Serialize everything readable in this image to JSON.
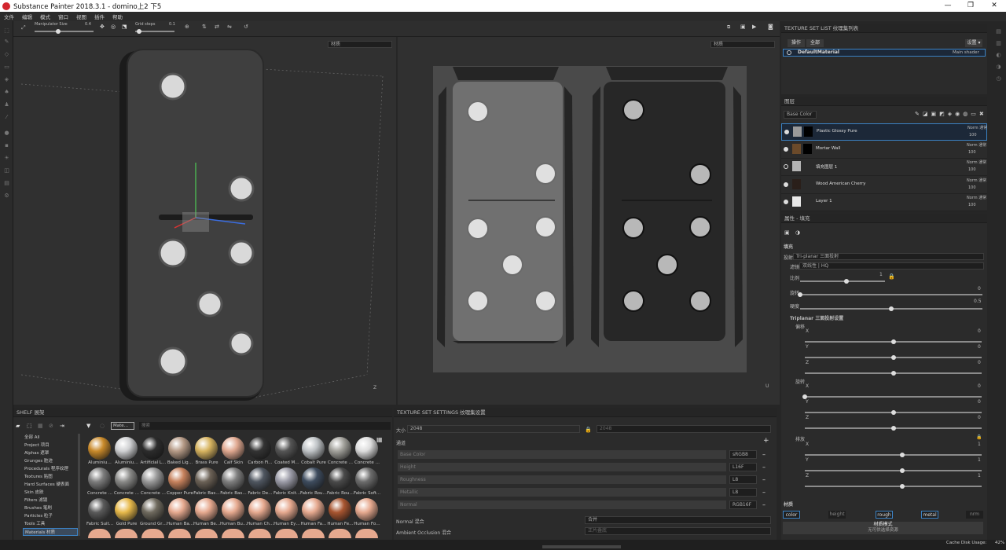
{
  "title": "Substance Painter 2018.3.1 - domino上2 下5",
  "window_controls": [
    "—",
    "❐",
    "✕"
  ],
  "menu": [
    "文件",
    "编辑",
    "模式",
    "窗口",
    "视图",
    "插件",
    "帮助"
  ],
  "toolbar": {
    "manipulator_label": "Manipulator Size",
    "manipulator_value": "0.4",
    "grid_label": "Grid steps",
    "grid_value": "0.1",
    "manipulator_frac": 0.4,
    "grid_frac": 0.1
  },
  "viewport3d": {
    "mode": "材质",
    "axis": "Z"
  },
  "viewport2d": {
    "mode": "材质",
    "axis": "U"
  },
  "texset_list": {
    "title": "TEXTURE SET LIST 纹理集列表",
    "btn1": "操作",
    "btn2": "全部",
    "settings": "设置 ▾",
    "item": "DefaultMaterial",
    "shader": "Main shader"
  },
  "layers": {
    "title": "图层",
    "channel": "Base Color",
    "items": [
      {
        "name": "Plastic Glossy Pure",
        "blend": "Norm 通常",
        "opacity": "100",
        "selected": true
      },
      {
        "name": "Mortar Wall",
        "blend": "Norm 通常",
        "opacity": "100",
        "selected": false
      },
      {
        "name": "填充图层 1",
        "blend": "Norm 通常",
        "opacity": "100",
        "selected": false
      },
      {
        "name": "Wood American Cherry",
        "blend": "Norm 通常",
        "opacity": "100",
        "selected": false
      },
      {
        "name": "Layer 1",
        "blend": "Norm 通常",
        "opacity": "100",
        "selected": false
      }
    ]
  },
  "properties": {
    "title": "属性 - 填充",
    "fill_title": "填充",
    "projection_label": "投射",
    "projection": "Tri-planar 三面投射",
    "filter_label": "滤镜",
    "filter": "双线性 | HQ",
    "scale_label": "比例",
    "scale_value": "1",
    "rotation_label": "旋转",
    "rotation_value": "0",
    "hardness_label": "硬度",
    "hardness_value": "0.5",
    "triplanar_title": "Triplanar 三面投射设置",
    "offset_label": "偏移",
    "rotate_label": "旋转",
    "tile_label": "排放",
    "offset": [
      {
        "axis": "X",
        "value": "0"
      },
      {
        "axis": "Y",
        "value": "0"
      },
      {
        "axis": "Z",
        "value": "0"
      }
    ],
    "rotate": [
      {
        "axis": "X",
        "value": "0"
      },
      {
        "axis": "Y",
        "value": "0"
      },
      {
        "axis": "Z",
        "value": "0"
      }
    ],
    "tile": [
      {
        "axis": "X",
        "value": "1"
      },
      {
        "axis": "Y",
        "value": "1"
      },
      {
        "axis": "Z",
        "value": "1"
      }
    ],
    "material_title": "材质",
    "channels": [
      "color",
      "height",
      "rough",
      "metal",
      "nrm"
    ],
    "material_mode": "材质模式",
    "material_mode_sub": "无可供选择资源"
  },
  "shelf": {
    "title": "SHELF 展架",
    "search_tag": "Mate…",
    "search_placeholder": "搜索",
    "categories": [
      "全部 All",
      "Project 项目",
      "Alphas 遮罩",
      "Grunges 脏迹",
      "Procedurals 程序纹理",
      "Textures 贴图",
      "Hard Surfaces 硬表面",
      "Skin 皮肤",
      "Filters 滤镜",
      "Brushes 笔刷",
      "Particles 粒子",
      "Tools 工具",
      "Materials 材质"
    ],
    "selected": "Materials 材质",
    "row1": [
      "Aluminiu…",
      "Aluminiu…",
      "Artificial L…",
      "Baked Lig…",
      "Brass Pure",
      "Calf Skin",
      "Carbon Fi…",
      "Coated M…",
      "Cobalt Pure",
      "Concrete …",
      "Concrete …"
    ],
    "row2": [
      "Concrete …",
      "Concrete …",
      "Concrete …",
      "Copper Pure",
      "Fabric Bas…",
      "Fabric Bas…",
      "Fabric De…",
      "Fabric Knit…",
      "Fabric Rou…",
      "Fabric Rou…",
      "Fabric Soft…"
    ],
    "row3": [
      "Fabric Suit…",
      "Gold Pure",
      "Ground Gr…",
      "Human Ba…",
      "Human Be…",
      "Human Bu…",
      "Human Ch…",
      "Human Ey…",
      "Human Fa…",
      "Human Fe…",
      "Human Fo…"
    ]
  },
  "tss": {
    "title": "TEXTURE SET SETTINGS 纹理集设置",
    "size_label": "大小",
    "size": "2048",
    "size2": "2048",
    "channels_label": "通道",
    "channels": [
      {
        "name": "Base Color",
        "fmt": "sRGB8"
      },
      {
        "name": "Height",
        "fmt": "L16F"
      },
      {
        "name": "Roughness",
        "fmt": "L8"
      },
      {
        "name": "Metallic",
        "fmt": "L8"
      },
      {
        "name": "Normal",
        "fmt": "RGB16F"
      }
    ],
    "normal_mix_label": "Normal 混合",
    "normal_mix": "合并",
    "ao_label": "Ambient Occlusion 混合",
    "ao": "正片叠底"
  },
  "status": {
    "cache": "Cache Disk Usage:",
    "cache_value": "42%"
  }
}
